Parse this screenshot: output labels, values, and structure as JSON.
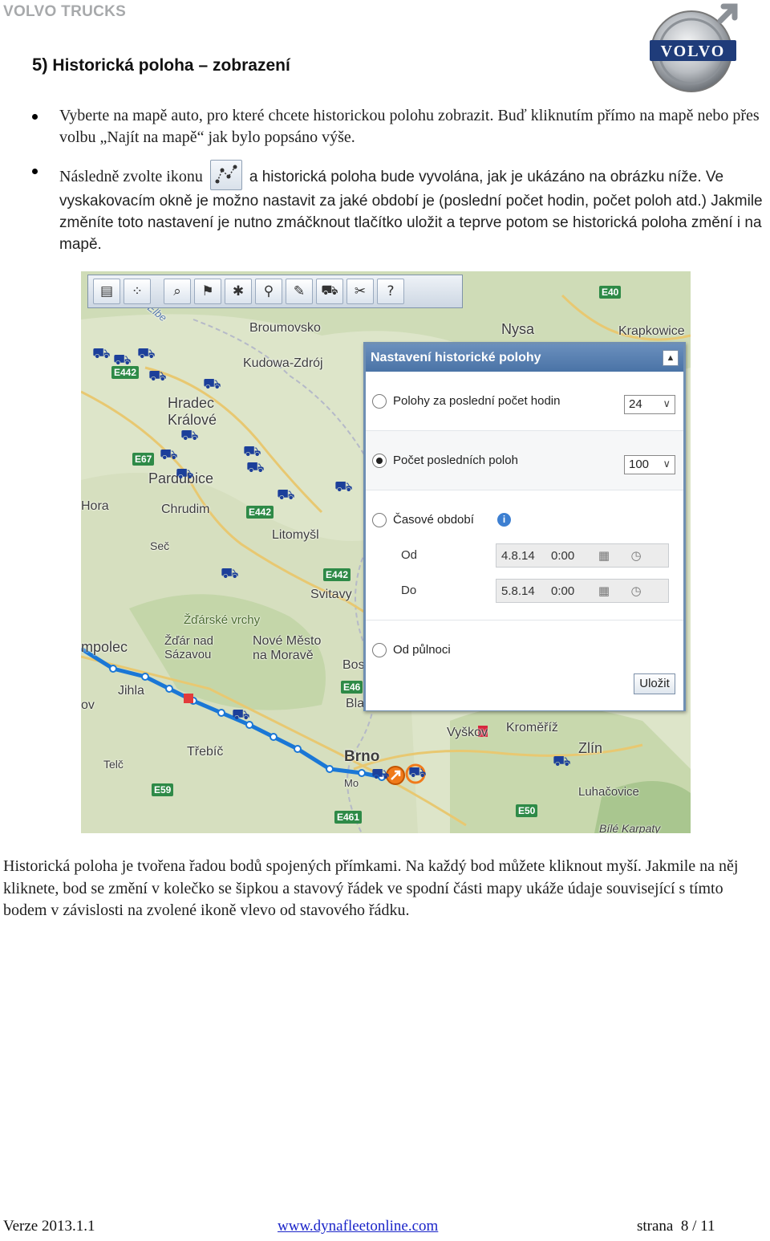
{
  "header": {
    "brand": "VOLVO TRUCKS",
    "logo_text": "VOLVO"
  },
  "heading": {
    "number": "5)",
    "title": "Historická poloha – zobrazení"
  },
  "bullets": [
    {
      "text": "Vyberte na mapě auto, pro které chcete historickou polohu zobrazit. Buď kliknutím přímo na mapě nebo přes volbu „Najít na mapě“ jak bylo popsáno výše."
    },
    {
      "before_icon": "Následně zvolte ikonu",
      "after_icon": "a historická poloha bude vyvolána, jak je ukázáno na obrázku",
      "rest": "níže. Ve vyskakovacím okně je možno nastavit za jaké období je (poslední počet hodin, počet poloh atd.) Jakmile změníte toto nastavení je nutno zmáčknout tlačítko uložit a teprve potom se historická poloha změní i na mapě."
    }
  ],
  "map": {
    "labels": [
      {
        "text": "Broumovsko"
      },
      {
        "text": "Nysa"
      },
      {
        "text": "Krapkowice"
      },
      {
        "text": "Kudowa-Zdrój"
      },
      {
        "text": "Hradec\nKrálové"
      },
      {
        "text": "Pardubice"
      },
      {
        "text": "Hora"
      },
      {
        "text": "Chrudim"
      },
      {
        "text": "Litomyšl"
      },
      {
        "text": "Seč"
      },
      {
        "text": "Svitavy"
      },
      {
        "text": "Žďárské vrchy"
      },
      {
        "text": "mpolec"
      },
      {
        "text": "Žďár nad\nSázavou"
      },
      {
        "text": "Nové Město\nna Moravě"
      },
      {
        "text": "Jihla"
      },
      {
        "text": "Třebíč"
      },
      {
        "text": "Telč"
      },
      {
        "text": "Brno"
      },
      {
        "text": "Vyškov"
      },
      {
        "text": "Kroměříž"
      },
      {
        "text": "Zlín"
      },
      {
        "text": "Luhačovice"
      },
      {
        "text": "Bílé Karpaty"
      },
      {
        "text": "Elbe"
      },
      {
        "text": "Bos"
      },
      {
        "text": "Bla"
      },
      {
        "text": "Mo"
      },
      {
        "text": "ov"
      }
    ],
    "roads": [
      "E40",
      "E442",
      "E67",
      "E442",
      "E442",
      "E461",
      "E59",
      "E50",
      "E46"
    ]
  },
  "toolbar": {
    "icons": [
      "list-icon",
      "history-route-icon",
      "zoom-area-icon",
      "flag-icon",
      "poi-add-icon",
      "route-icon",
      "pin-icon",
      "truck-list-icon",
      "settings-icon",
      "help-icon"
    ]
  },
  "dialog": {
    "title": "Nastavení historické polohy",
    "options": [
      {
        "label": "Polohy za poslední počet hodin",
        "value": "24",
        "selected": false
      },
      {
        "label": "Počet posledních poloh",
        "value": "100",
        "selected": true
      },
      {
        "label": "Časové období",
        "selected": false
      },
      {
        "label": "Od půlnoci",
        "selected": false
      }
    ],
    "from_label": "Od",
    "from_date": "4.8.14",
    "from_time": "0:00",
    "to_label": "Do",
    "to_date": "5.8.14",
    "to_time": "0:00",
    "save_label": "Uložit"
  },
  "paragraph": "Historická poloha je tvořena řadou bodů spojených přímkami. Na každý bod můžete kliknout myší. Jakmile na něj kliknete, bod se změní v kolečko se šipkou a stavový řádek ve spodní části mapy ukáže údaje související s tímto bodem v závislosti na zvolené ikoně vlevo od stavového řádku.",
  "footer": {
    "version": "Verze 2013.1.1",
    "link": "www.dynafleetonline.com",
    "page": "strana  8 / 11"
  }
}
